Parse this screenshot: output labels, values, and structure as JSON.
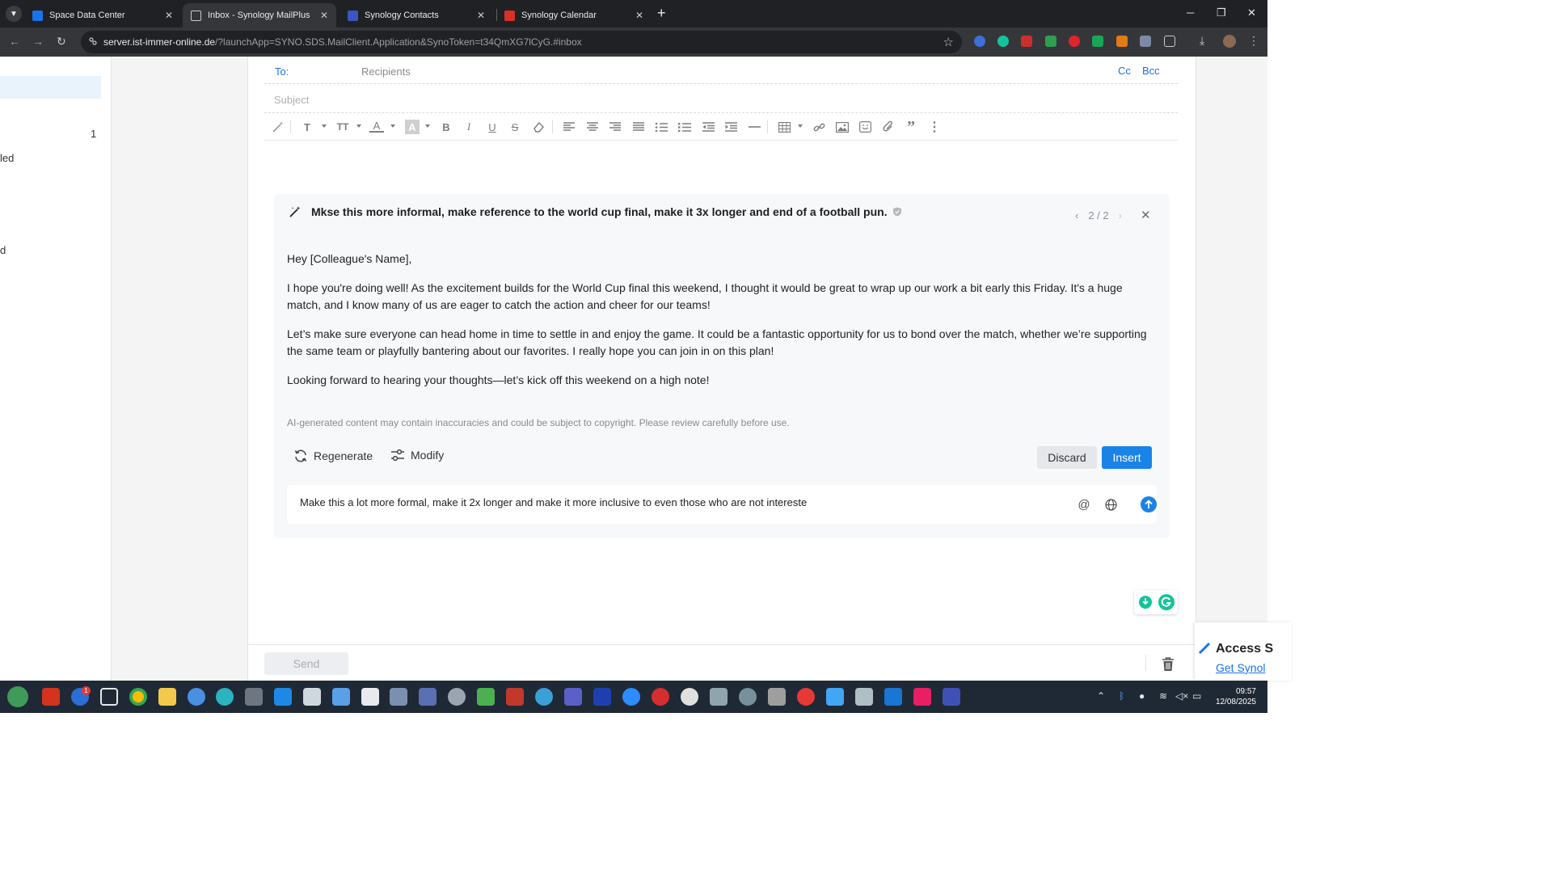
{
  "browser": {
    "tabs": [
      {
        "label": "Space Data Center",
        "favicon_color": "#1a73e8"
      },
      {
        "label": "Inbox - Synology MailPlus",
        "favicon_color": "#5f6368"
      },
      {
        "label": "Synology Contacts",
        "favicon_color": "#3b56c4"
      },
      {
        "label": "Synology Calendar",
        "favicon_color": "#d93025"
      }
    ],
    "url_host": "server.ist-immer-online.de",
    "url_path": "/?launchApp=SYNO.SDS.MailClient.Application&SynoToken=t34QmXG7lCyG.#inbox"
  },
  "sidebar": {
    "unread_count": "1",
    "fragment_1": "led",
    "fragment_2": "d"
  },
  "compose": {
    "to_label": "To:",
    "recipients_placeholder": "Recipients",
    "cc_label": "Cc",
    "bcc_label": "Bcc",
    "subject_placeholder": "Subject",
    "send_label": "Send"
  },
  "ai": {
    "prompt": "Mkse this more informal, make reference to the world cup final, make it 3x longer and end of a football pun.",
    "pager": "2 / 2",
    "body": [
      "Hey [Colleague's Name],",
      "I hope you're doing well! As the excitement builds for the World Cup final this weekend, I thought it would be great to wrap up our work a bit early this Friday. It's a huge match, and I know many of us are eager to catch the action and cheer for our teams!",
      "Let’s make sure everyone can head home in time to settle in and enjoy the game. It could be a fantastic opportunity for us to bond over the match, whether we’re supporting the same team or playfully bantering about our favorites. I really hope you can join in on this plan!",
      "Looking forward to hearing your thoughts—let’s kick off this weekend on a high note!"
    ],
    "disclaimer": "AI-generated content may contain inaccuracies and could be subject to copyright. Please review carefully before use.",
    "regenerate_label": "Regenerate",
    "modify_label": "Modify",
    "discard_label": "Discard",
    "insert_label": "Insert",
    "input_value": "Make this a lot more formal, make it 2x longer and make it more inclusive to even those who are not intereste",
    "at_symbol": "@"
  },
  "toast": {
    "title": "Access S",
    "link": "Get Synol"
  },
  "taskbar": {
    "time": "09:57",
    "date": "12/08/2025",
    "badge": "1"
  },
  "colors": {
    "accent": "#1a84e6",
    "link": "#1a73e8"
  }
}
